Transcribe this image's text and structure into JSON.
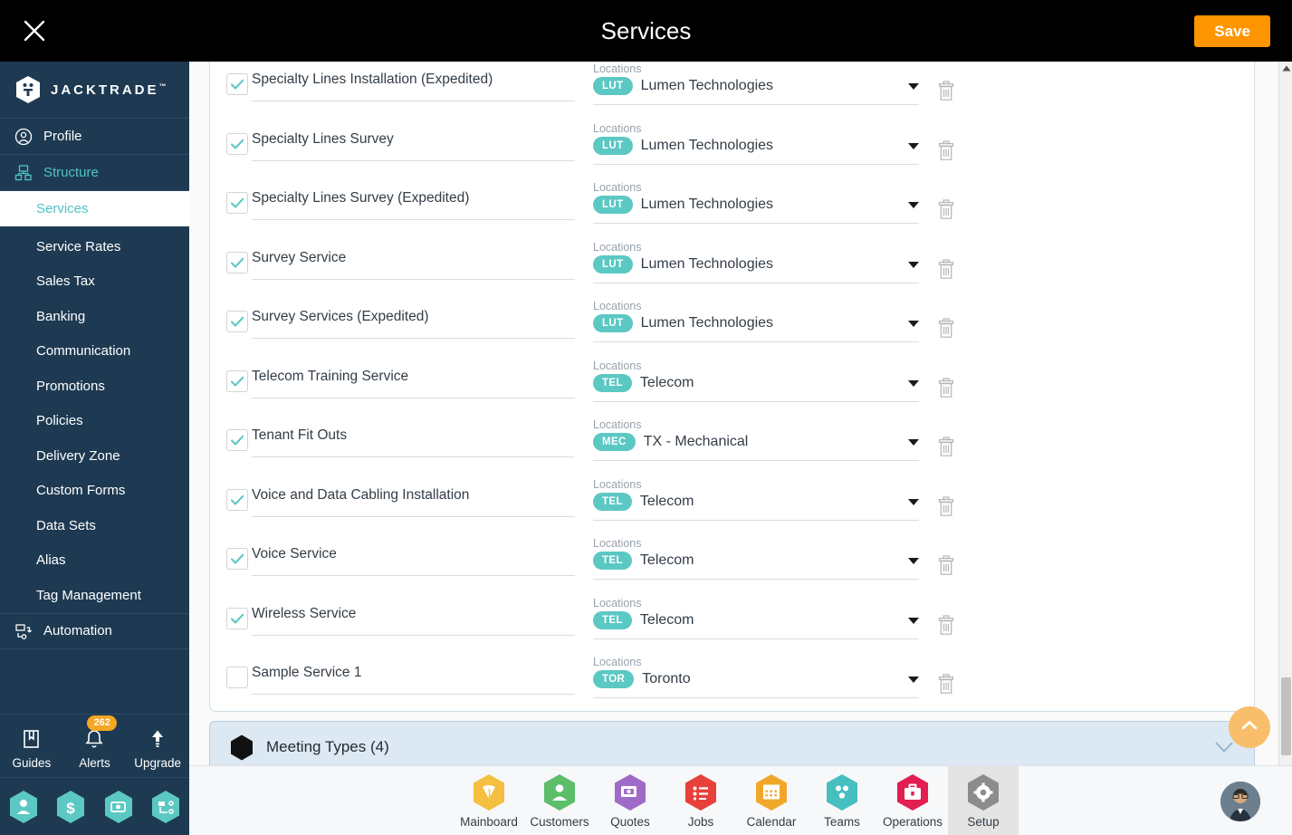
{
  "topbar": {
    "title": "Services",
    "close_icon": "close-icon",
    "save_label": "Save"
  },
  "sidebar": {
    "brand": {
      "name": "JACKTRADE",
      "tm": "™",
      "logo_icon": "jacktrade-logo-icon"
    },
    "top_items": [
      {
        "label": "Profile",
        "icon": "user-circle-icon",
        "active": false
      },
      {
        "label": "Structure",
        "icon": "structure-icon",
        "active": true
      }
    ],
    "active_sub": {
      "label": "Services"
    },
    "sub_items": [
      {
        "label": "Service Rates"
      },
      {
        "label": "Sales Tax"
      },
      {
        "label": "Banking"
      },
      {
        "label": "Communication"
      },
      {
        "label": "Promotions"
      },
      {
        "label": "Policies"
      },
      {
        "label": "Delivery Zone"
      },
      {
        "label": "Custom Forms"
      },
      {
        "label": "Data Sets"
      },
      {
        "label": "Alias"
      },
      {
        "label": "Tag Management"
      }
    ],
    "automation": {
      "label": "Automation",
      "icon": "automation-icon"
    },
    "tools": [
      {
        "label": "Guides",
        "icon": "book-icon",
        "badge": ""
      },
      {
        "label": "Alerts",
        "icon": "bell-icon",
        "badge": "262"
      },
      {
        "label": "Upgrade",
        "icon": "arrow-up-icon",
        "badge": ""
      }
    ],
    "quick_icons": [
      {
        "icon": "person-hex-icon"
      },
      {
        "icon": "dollar-hex-icon"
      },
      {
        "icon": "money-hex-icon"
      },
      {
        "icon": "workflow-hex-icon"
      }
    ]
  },
  "main": {
    "location_label": "Locations",
    "rows": [
      {
        "service": "Specialty Lines Installation (Expedited)",
        "checked": true,
        "loc_code": "LUT",
        "loc_name": "Lumen Technologies"
      },
      {
        "service": "Specialty Lines Survey",
        "checked": true,
        "loc_code": "LUT",
        "loc_name": "Lumen Technologies"
      },
      {
        "service": "Specialty Lines Survey (Expedited)",
        "checked": true,
        "loc_code": "LUT",
        "loc_name": "Lumen Technologies"
      },
      {
        "service": "Survey Service",
        "checked": true,
        "loc_code": "LUT",
        "loc_name": "Lumen Technologies"
      },
      {
        "service": "Survey Services (Expedited)",
        "checked": true,
        "loc_code": "LUT",
        "loc_name": "Lumen Technologies"
      },
      {
        "service": "Telecom Training Service",
        "checked": true,
        "loc_code": "TEL",
        "loc_name": "Telecom"
      },
      {
        "service": "Tenant Fit Outs",
        "checked": true,
        "loc_code": "MEC",
        "loc_name": "TX - Mechanical"
      },
      {
        "service": "Voice and Data Cabling Installation",
        "checked": true,
        "loc_code": "TEL",
        "loc_name": "Telecom"
      },
      {
        "service": "Voice Service",
        "checked": true,
        "loc_code": "TEL",
        "loc_name": "Telecom"
      },
      {
        "service": "Wireless Service",
        "checked": true,
        "loc_code": "TEL",
        "loc_name": "Telecom"
      },
      {
        "service": "Sample Service 1",
        "checked": false,
        "loc_code": "TOR",
        "loc_name": "Toronto"
      }
    ],
    "meeting_types": {
      "label": "Meeting Types (4)",
      "chevron_icon": "chevron-down-icon",
      "hex_icon": "hexagon-icon"
    },
    "scroll_top_icon": "chevron-up-icon"
  },
  "bottomnav": {
    "items": [
      {
        "label": "Mainboard",
        "icon": "mainboard-icon",
        "color": "#F5BF3F",
        "active": false
      },
      {
        "label": "Customers",
        "icon": "customers-icon",
        "color": "#5CBE6A",
        "active": false
      },
      {
        "label": "Quotes",
        "icon": "quotes-icon",
        "color": "#A06BC8",
        "active": false
      },
      {
        "label": "Jobs",
        "icon": "jobs-icon",
        "color": "#E8403A",
        "active": false
      },
      {
        "label": "Calendar",
        "icon": "calendar-icon",
        "color": "#F0A82B",
        "active": false
      },
      {
        "label": "Teams",
        "icon": "teams-icon",
        "color": "#45BFC0",
        "active": false
      },
      {
        "label": "Operations",
        "icon": "operations-icon",
        "color": "#E31E52",
        "active": false
      },
      {
        "label": "Setup",
        "icon": "setup-gear-icon",
        "color": "#8C8C8C",
        "active": true
      }
    ],
    "avatar_icon": "user-avatar"
  },
  "colors": {
    "accent_teal": "#5BC8C4",
    "sidebar_bg": "#1E3A52",
    "save_orange": "#FF9500",
    "panel_blue": "#DCE8F2"
  }
}
